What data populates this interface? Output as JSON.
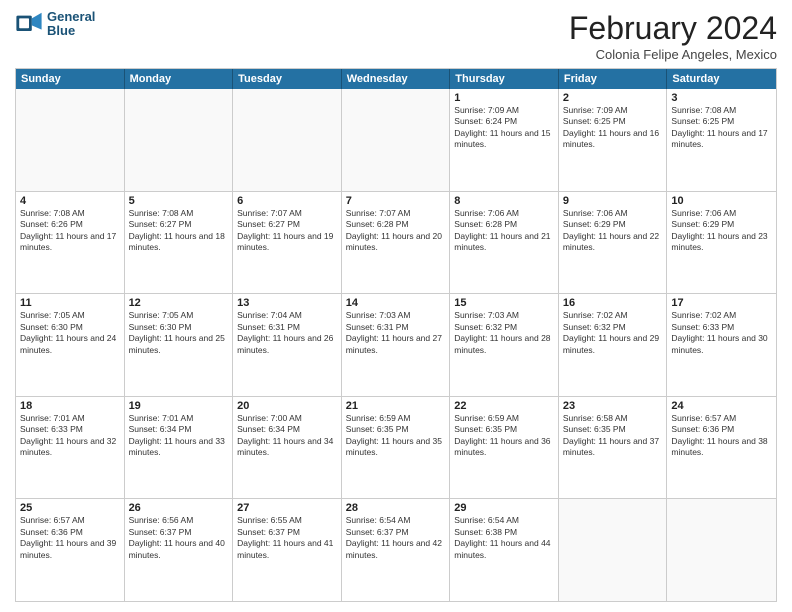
{
  "logo": {
    "line1": "General",
    "line2": "Blue"
  },
  "title": "February 2024",
  "subtitle": "Colonia Felipe Angeles, Mexico",
  "header_days": [
    "Sunday",
    "Monday",
    "Tuesday",
    "Wednesday",
    "Thursday",
    "Friday",
    "Saturday"
  ],
  "rows": [
    [
      {
        "day": "",
        "info": ""
      },
      {
        "day": "",
        "info": ""
      },
      {
        "day": "",
        "info": ""
      },
      {
        "day": "",
        "info": ""
      },
      {
        "day": "1",
        "info": "Sunrise: 7:09 AM\nSunset: 6:24 PM\nDaylight: 11 hours and 15 minutes."
      },
      {
        "day": "2",
        "info": "Sunrise: 7:09 AM\nSunset: 6:25 PM\nDaylight: 11 hours and 16 minutes."
      },
      {
        "day": "3",
        "info": "Sunrise: 7:08 AM\nSunset: 6:25 PM\nDaylight: 11 hours and 17 minutes."
      }
    ],
    [
      {
        "day": "4",
        "info": "Sunrise: 7:08 AM\nSunset: 6:26 PM\nDaylight: 11 hours and 17 minutes."
      },
      {
        "day": "5",
        "info": "Sunrise: 7:08 AM\nSunset: 6:27 PM\nDaylight: 11 hours and 18 minutes."
      },
      {
        "day": "6",
        "info": "Sunrise: 7:07 AM\nSunset: 6:27 PM\nDaylight: 11 hours and 19 minutes."
      },
      {
        "day": "7",
        "info": "Sunrise: 7:07 AM\nSunset: 6:28 PM\nDaylight: 11 hours and 20 minutes."
      },
      {
        "day": "8",
        "info": "Sunrise: 7:06 AM\nSunset: 6:28 PM\nDaylight: 11 hours and 21 minutes."
      },
      {
        "day": "9",
        "info": "Sunrise: 7:06 AM\nSunset: 6:29 PM\nDaylight: 11 hours and 22 minutes."
      },
      {
        "day": "10",
        "info": "Sunrise: 7:06 AM\nSunset: 6:29 PM\nDaylight: 11 hours and 23 minutes."
      }
    ],
    [
      {
        "day": "11",
        "info": "Sunrise: 7:05 AM\nSunset: 6:30 PM\nDaylight: 11 hours and 24 minutes."
      },
      {
        "day": "12",
        "info": "Sunrise: 7:05 AM\nSunset: 6:30 PM\nDaylight: 11 hours and 25 minutes."
      },
      {
        "day": "13",
        "info": "Sunrise: 7:04 AM\nSunset: 6:31 PM\nDaylight: 11 hours and 26 minutes."
      },
      {
        "day": "14",
        "info": "Sunrise: 7:03 AM\nSunset: 6:31 PM\nDaylight: 11 hours and 27 minutes."
      },
      {
        "day": "15",
        "info": "Sunrise: 7:03 AM\nSunset: 6:32 PM\nDaylight: 11 hours and 28 minutes."
      },
      {
        "day": "16",
        "info": "Sunrise: 7:02 AM\nSunset: 6:32 PM\nDaylight: 11 hours and 29 minutes."
      },
      {
        "day": "17",
        "info": "Sunrise: 7:02 AM\nSunset: 6:33 PM\nDaylight: 11 hours and 30 minutes."
      }
    ],
    [
      {
        "day": "18",
        "info": "Sunrise: 7:01 AM\nSunset: 6:33 PM\nDaylight: 11 hours and 32 minutes."
      },
      {
        "day": "19",
        "info": "Sunrise: 7:01 AM\nSunset: 6:34 PM\nDaylight: 11 hours and 33 minutes."
      },
      {
        "day": "20",
        "info": "Sunrise: 7:00 AM\nSunset: 6:34 PM\nDaylight: 11 hours and 34 minutes."
      },
      {
        "day": "21",
        "info": "Sunrise: 6:59 AM\nSunset: 6:35 PM\nDaylight: 11 hours and 35 minutes."
      },
      {
        "day": "22",
        "info": "Sunrise: 6:59 AM\nSunset: 6:35 PM\nDaylight: 11 hours and 36 minutes."
      },
      {
        "day": "23",
        "info": "Sunrise: 6:58 AM\nSunset: 6:35 PM\nDaylight: 11 hours and 37 minutes."
      },
      {
        "day": "24",
        "info": "Sunrise: 6:57 AM\nSunset: 6:36 PM\nDaylight: 11 hours and 38 minutes."
      }
    ],
    [
      {
        "day": "25",
        "info": "Sunrise: 6:57 AM\nSunset: 6:36 PM\nDaylight: 11 hours and 39 minutes."
      },
      {
        "day": "26",
        "info": "Sunrise: 6:56 AM\nSunset: 6:37 PM\nDaylight: 11 hours and 40 minutes."
      },
      {
        "day": "27",
        "info": "Sunrise: 6:55 AM\nSunset: 6:37 PM\nDaylight: 11 hours and 41 minutes."
      },
      {
        "day": "28",
        "info": "Sunrise: 6:54 AM\nSunset: 6:37 PM\nDaylight: 11 hours and 42 minutes."
      },
      {
        "day": "29",
        "info": "Sunrise: 6:54 AM\nSunset: 6:38 PM\nDaylight: 11 hours and 44 minutes."
      },
      {
        "day": "",
        "info": ""
      },
      {
        "day": "",
        "info": ""
      }
    ]
  ]
}
